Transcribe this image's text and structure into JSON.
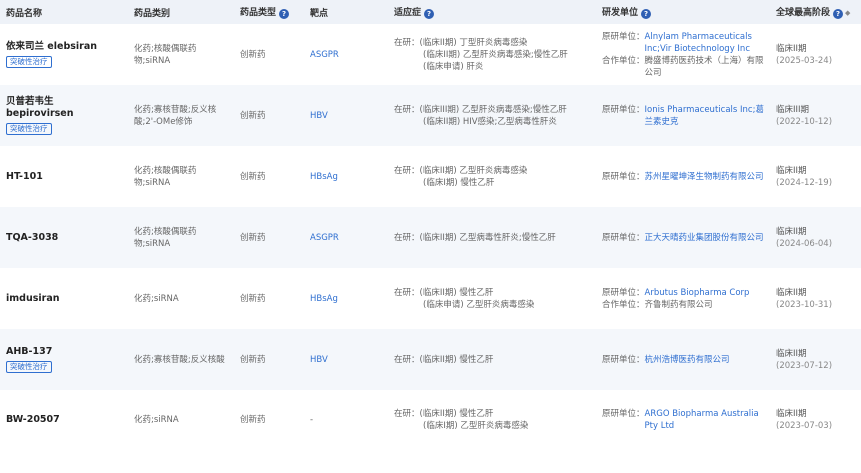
{
  "header": {
    "name": "药品名称",
    "category": "药品类别",
    "type": "药品类型",
    "target": "靶点",
    "indication": "适应症",
    "org": "研发单位",
    "phase": "全球最高阶段"
  },
  "rows": [
    {
      "name": "依来司兰 elebsiran",
      "badge": "突破性治疗",
      "category": "化药;核酸偶联药物;siRNA",
      "type": "创新药",
      "target": "ASGPR",
      "ind_prefix": "在研：",
      "indications": [
        "(临床II期) 丁型肝炎病毒感染",
        "(临床II期) 乙型肝炎病毒感染;慢性乙肝",
        "(临床申请) 肝炎"
      ],
      "org_label": "原研单位：",
      "org": "Alnylam Pharmaceuticals Inc;Vir Biotechnology Inc",
      "partner_label": "合作单位：",
      "partner": "腾盛博药医药技术（上海）有限公司",
      "phase": "临床II期",
      "date": "(2025-03-24)"
    },
    {
      "name": "贝普若韦生 bepirovirsen",
      "badge": "突破性治疗",
      "category": "化药;寡核苷酸;反义核酸;2'-OMe修饰",
      "type": "创新药",
      "target": "HBV",
      "ind_prefix": "在研：",
      "indications": [
        "(临床III期) 乙型肝炎病毒感染;慢性乙肝",
        "(临床II期) HIV感染;乙型病毒性肝炎"
      ],
      "org_label": "原研单位：",
      "org": "Ionis Pharmaceuticals Inc;葛兰素史克",
      "partner_label": "",
      "partner": "",
      "phase": "临床III期",
      "date": "(2022-10-12)"
    },
    {
      "name": "HT-101",
      "badge": "",
      "category": "化药;核酸偶联药物;siRNA",
      "type": "创新药",
      "target": "HBsAg",
      "ind_prefix": "在研：",
      "indications": [
        "(临床II期) 乙型肝炎病毒感染",
        "(临床I期) 慢性乙肝"
      ],
      "org_label": "原研单位：",
      "org": "苏州星曜坤泽生物制药有限公司",
      "partner_label": "",
      "partner": "",
      "phase": "临床II期",
      "date": "(2024-12-19)"
    },
    {
      "name": "TQA-3038",
      "badge": "",
      "category": "化药;核酸偶联药物;siRNA",
      "type": "创新药",
      "target": "ASGPR",
      "ind_prefix": "在研：",
      "indications": [
        "(临床II期) 乙型病毒性肝炎;慢性乙肝"
      ],
      "org_label": "原研单位：",
      "org": "正大天晴药业集团股份有限公司",
      "partner_label": "",
      "partner": "",
      "phase": "临床II期",
      "date": "(2024-06-04)"
    },
    {
      "name": "imdusiran",
      "badge": "",
      "category": "化药;siRNA",
      "type": "创新药",
      "target": "HBsAg",
      "ind_prefix": "在研：",
      "indications": [
        "(临床II期) 慢性乙肝",
        "(临床申请) 乙型肝炎病毒感染"
      ],
      "org_label": "原研单位：",
      "org": "Arbutus Biopharma Corp",
      "partner_label": "合作单位：",
      "partner": "齐鲁制药有限公司",
      "phase": "临床II期",
      "date": "(2023-10-31)"
    },
    {
      "name": "AHB-137",
      "badge": "突破性治疗",
      "category": "化药;寡核苷酸;反义核酸",
      "type": "创新药",
      "target": "HBV",
      "ind_prefix": "在研：",
      "indications": [
        "(临床II期) 慢性乙肝"
      ],
      "org_label": "原研单位：",
      "org": "杭州浩博医药有限公司",
      "partner_label": "",
      "partner": "",
      "phase": "临床II期",
      "date": "(2023-07-12)"
    },
    {
      "name": "BW-20507",
      "badge": "",
      "category": "化药;siRNA",
      "type": "创新药",
      "target": "-",
      "ind_prefix": "在研：",
      "indications": [
        "(临床II期) 慢性乙肝",
        "(临床I期) 乙型肝炎病毒感染"
      ],
      "org_label": "原研单位：",
      "org": "ARGO Biopharma Australia Pty Ltd",
      "partner_label": "",
      "partner": "",
      "phase": "临床II期",
      "date": "(2023-07-03)"
    }
  ]
}
